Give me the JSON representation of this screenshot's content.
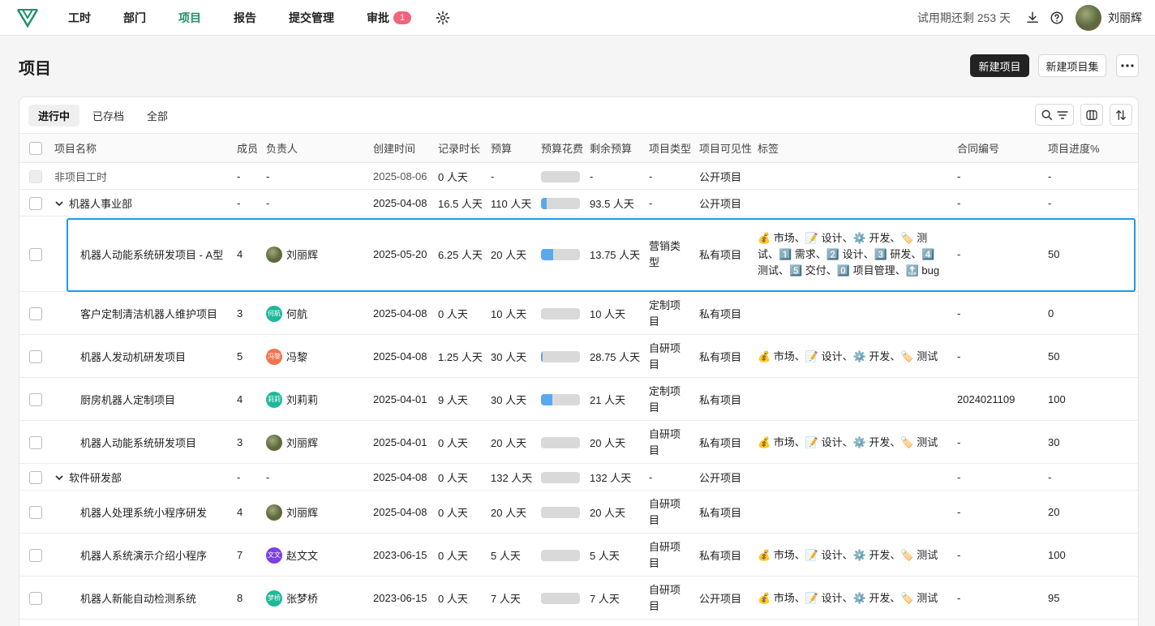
{
  "nav": {
    "items": [
      {
        "label": "工时"
      },
      {
        "label": "部门"
      },
      {
        "label": "项目"
      },
      {
        "label": "报告"
      },
      {
        "label": "提交管理"
      },
      {
        "label": "审批"
      }
    ],
    "approval_badge": "1",
    "trial_text": "试用期还剩 253 天",
    "username": "刘丽辉",
    "active_color": "#1f8f6a"
  },
  "page": {
    "title": "项目",
    "new_project": "新建项目",
    "new_project_set": "新建项目集",
    "more": "···"
  },
  "tabs": [
    {
      "label": "进行中",
      "active": true
    },
    {
      "label": "已存档"
    },
    {
      "label": "全部"
    }
  ],
  "columns": [
    "项目名称",
    "成员",
    "负责人",
    "创建时间",
    "记录时长",
    "预算",
    "预算花费",
    "剩余预算",
    "项目类型",
    "项目可见性",
    "标签",
    "合同编号",
    "项目进度%"
  ],
  "rows": [
    {
      "name": "非项目工时",
      "members": "-",
      "owner": "-",
      "created": "2025-08-06",
      "duration": "0 人天",
      "budget": "-",
      "spent_fraction": 0,
      "remaining": "-",
      "type": "-",
      "visibility": "公开项目",
      "tags": "",
      "contract": "-",
      "progress": "-"
    },
    {
      "name": "机器人事业部",
      "members": "-",
      "owner": "-",
      "created": "2025-04-08",
      "duration": "16.5 人天",
      "budget": "110 人天",
      "spent_fraction": 0.15,
      "remaining": "93.5 人天",
      "type": "-",
      "visibility": "公开项目",
      "tags": "",
      "contract": "-",
      "progress": "-"
    },
    {
      "name": "机器人动能系统研发项目 - A型",
      "members": "4",
      "owner": "刘丽辉",
      "owner_avatar": "",
      "created": "2025-05-20",
      "duration": "6.25 人天",
      "budget": "20 人天",
      "spent_fraction": 0.31,
      "remaining": "13.75 人天",
      "type": "营销类型",
      "visibility": "私有项目",
      "tags": "💰 市场、📝 设计、⚙️ 开发、🏷️ 测试、1️⃣ 需求、2️⃣ 设计、3️⃣ 研发、4️⃣ 测试、5️⃣ 交付、0️⃣ 项目管理、🔝 bug",
      "contract": "-",
      "progress": "50"
    },
    {
      "name": "客户定制清洁机器人维护项目",
      "members": "3",
      "owner": "何航",
      "owner_avatar": "何航",
      "created": "2025-04-08",
      "duration": "0 人天",
      "budget": "10 人天",
      "spent_fraction": 0,
      "remaining": "10 人天",
      "type": "定制项目",
      "visibility": "私有项目",
      "tags": "",
      "contract": "-",
      "progress": "0"
    },
    {
      "name": "机器人发动机研发项目",
      "members": "5",
      "owner": "冯黎",
      "owner_avatar": "冯黎",
      "created": "2025-04-08",
      "duration": "1.25 人天",
      "budget": "30 人天",
      "spent_fraction": 0.04,
      "remaining": "28.75 人天",
      "type": "自研项目",
      "visibility": "私有项目",
      "tags": "💰 市场、📝 设计、⚙️ 开发、🏷️ 测试",
      "contract": "-",
      "progress": "50"
    },
    {
      "name": "厨房机器人定制项目",
      "members": "4",
      "owner": "刘莉莉",
      "owner_avatar": "莉莉",
      "created": "2025-04-01",
      "duration": "9 人天",
      "budget": "30 人天",
      "spent_fraction": 0.3,
      "remaining": "21 人天",
      "type": "定制项目",
      "visibility": "私有项目",
      "tags": "",
      "contract": "2024021109",
      "progress": "100"
    },
    {
      "name": "机器人动能系统研发项目",
      "members": "3",
      "owner": "刘丽辉",
      "owner_avatar": "",
      "created": "2025-04-01",
      "duration": "0 人天",
      "budget": "20 人天",
      "spent_fraction": 0,
      "remaining": "20 人天",
      "type": "自研项目",
      "visibility": "私有项目",
      "tags": "💰 市场、📝 设计、⚙️ 开发、🏷️ 测试",
      "contract": "-",
      "progress": "30"
    },
    {
      "name": "软件研发部",
      "members": "-",
      "owner": "-",
      "created": "2025-04-08",
      "duration": "0 人天",
      "budget": "132 人天",
      "spent_fraction": 0,
      "remaining": "132 人天",
      "type": "-",
      "visibility": "公开项目",
      "tags": "",
      "contract": "-",
      "progress": "-"
    },
    {
      "name": "机器人处理系统小程序研发",
      "members": "4",
      "owner": "刘丽辉",
      "owner_avatar": "",
      "created": "2025-04-08",
      "duration": "0 人天",
      "budget": "20 人天",
      "spent_fraction": 0,
      "remaining": "20 人天",
      "type": "自研项目",
      "visibility": "私有项目",
      "tags": "",
      "contract": "-",
      "progress": "20"
    },
    {
      "name": "机器人系统演示介绍小程序",
      "members": "7",
      "owner": "赵文文",
      "owner_avatar": "文文",
      "created": "2023-06-15",
      "duration": "0 人天",
      "budget": "5 人天",
      "spent_fraction": 0,
      "remaining": "5 人天",
      "type": "自研项目",
      "visibility": "私有项目",
      "tags": "💰 市场、📝 设计、⚙️ 开发、🏷️ 测试",
      "contract": "-",
      "progress": "100"
    },
    {
      "name": "机器人新能自动检测系统",
      "members": "8",
      "owner": "张梦桥",
      "owner_avatar": "梦桥",
      "created": "2023-06-15",
      "duration": "0 人天",
      "budget": "7 人天",
      "spent_fraction": 0,
      "remaining": "7 人天",
      "type": "自研项目",
      "visibility": "公开项目",
      "tags": "💰 市场、📝 设计、⚙️ 开发、🏷️ 测试",
      "contract": "-",
      "progress": "95"
    }
  ]
}
